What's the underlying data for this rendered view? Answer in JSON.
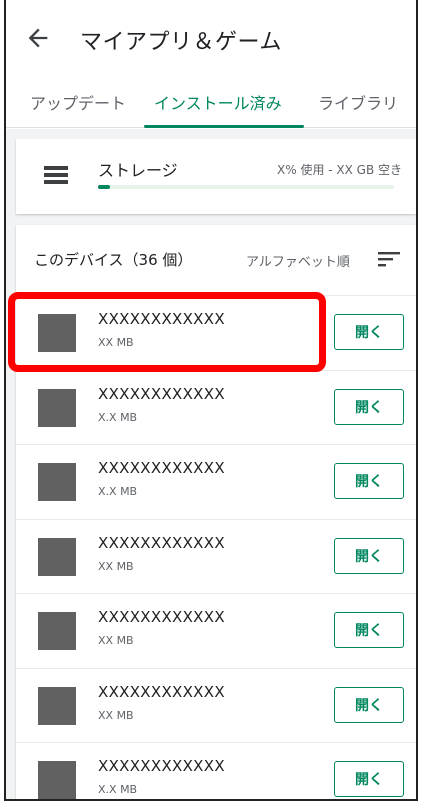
{
  "header": {
    "title": "マイアプリ＆ゲーム"
  },
  "tabs": [
    {
      "label": "アップデート",
      "active": false
    },
    {
      "label": "インストール済み",
      "active": true
    },
    {
      "label": "ライブラリ",
      "active": false
    }
  ],
  "storage": {
    "label": "ストレージ",
    "usage": "X% 使用 - XX GB 空き",
    "used_fraction": 0.04
  },
  "device_list": {
    "count_label": "このデバイス（36 個）",
    "sort_label": "アルファベット順"
  },
  "apps": [
    {
      "name": "XXXXXXXXXXXX",
      "size": "XX MB",
      "action": "開く"
    },
    {
      "name": "XXXXXXXXXXXX",
      "size": "X.X MB",
      "action": "開く"
    },
    {
      "name": "XXXXXXXXXXXX",
      "size": "X.X MB",
      "action": "開く"
    },
    {
      "name": "XXXXXXXXXXXX",
      "size": "XX MB",
      "action": "開く"
    },
    {
      "name": "XXXXXXXXXXXX",
      "size": "XX MB",
      "action": "開く"
    },
    {
      "name": "XXXXXXXXXXXX",
      "size": "XX MB",
      "action": "開く"
    },
    {
      "name": "XXXXXXXXXXXX",
      "size": "X.X MB",
      "action": "開く"
    }
  ],
  "colors": {
    "accent": "#01875f",
    "highlight": "#ff0000",
    "icon_placeholder": "#616161"
  },
  "icons": {
    "back": "arrow-back-icon",
    "storage": "storage-icon",
    "sort": "sort-icon"
  }
}
